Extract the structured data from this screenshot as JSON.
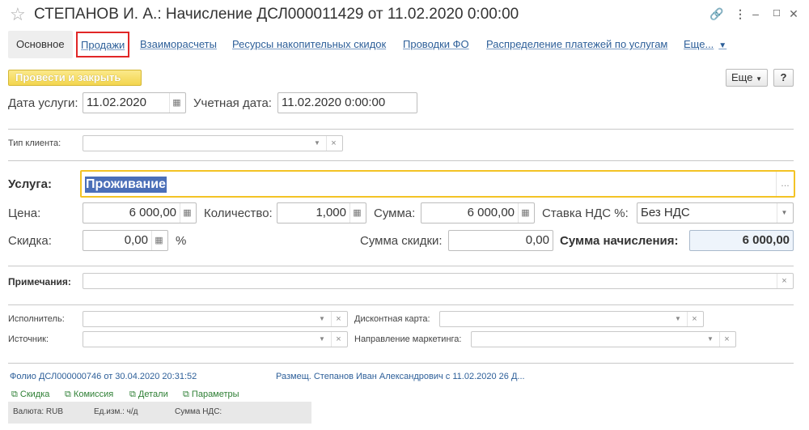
{
  "window": {
    "title": "СТЕПАНОВ И. А.: Начисление ДСЛ000011429 от 11.02.2020 0:00:00",
    "link_icon": "link-icon",
    "menu_icon": "more-vertical-icon",
    "minimize_icon": "minimize-icon",
    "close_icon": "close-icon"
  },
  "tabs": [
    {
      "label": "Основное"
    },
    {
      "label": "Продажи"
    },
    {
      "label": "Взаиморасчеты"
    },
    {
      "label": "Ресурсы накопительных скидок"
    },
    {
      "label": "Проводки ФО"
    },
    {
      "label": "Распределение платежей по услугам"
    },
    {
      "label": "Еще..."
    }
  ],
  "toolbar": {
    "post_close": "Провести и закрыть",
    "more": "Еще",
    "help": "?"
  },
  "service_date": {
    "label": "Дата услуги:",
    "value": "11.02.2020"
  },
  "account_date": {
    "label": "Учетная дата:",
    "value": "11.02.2020  0:00:00"
  },
  "client_type": {
    "label": "Тип клиента:",
    "value": ""
  },
  "service": {
    "label": "Услуга:",
    "value": "Проживание"
  },
  "price": {
    "label": "Цена:",
    "value": "6 000,00"
  },
  "quantity": {
    "label": "Количество:",
    "value": "1,000"
  },
  "sum": {
    "label": "Сумма:",
    "value": "6 000,00"
  },
  "vat_rate": {
    "label": "Ставка НДС %:",
    "value": "Без НДС"
  },
  "discount": {
    "label": "Скидка:",
    "value": "0,00",
    "unit": "%"
  },
  "discount_sum": {
    "label": "Сумма скидки:",
    "value": "0,00"
  },
  "charge_sum": {
    "label": "Сумма начисления:",
    "value": "6 000,00"
  },
  "notes": {
    "label": "Примечания:",
    "value": ""
  },
  "executor": {
    "label": "Исполнитель:",
    "value": ""
  },
  "discount_card": {
    "label": "Дисконтная карта:",
    "value": ""
  },
  "source": {
    "label": "Источник:",
    "value": ""
  },
  "marketing": {
    "label": "Направление маркетинга:",
    "value": ""
  },
  "links": {
    "folio": "Фолио ДСЛ000000746 от 30.04.2020 20:31:52",
    "placement": "Размещ. Степанов Иван Александрович с 11.02.2020 26 Д..."
  },
  "actions": [
    "Скидка",
    "Комиссия",
    "Детали",
    "Параметры"
  ],
  "footer": {
    "currency": "Валюта: RUB",
    "unit": "Ед.изм.: ч/д",
    "vat_sum": "Сумма НДС:"
  },
  "colors": {
    "accent_link": "#2d5f99",
    "highlight_border": "#e12727",
    "focus_border": "#f3c325",
    "post_button": "#f3d54e"
  }
}
